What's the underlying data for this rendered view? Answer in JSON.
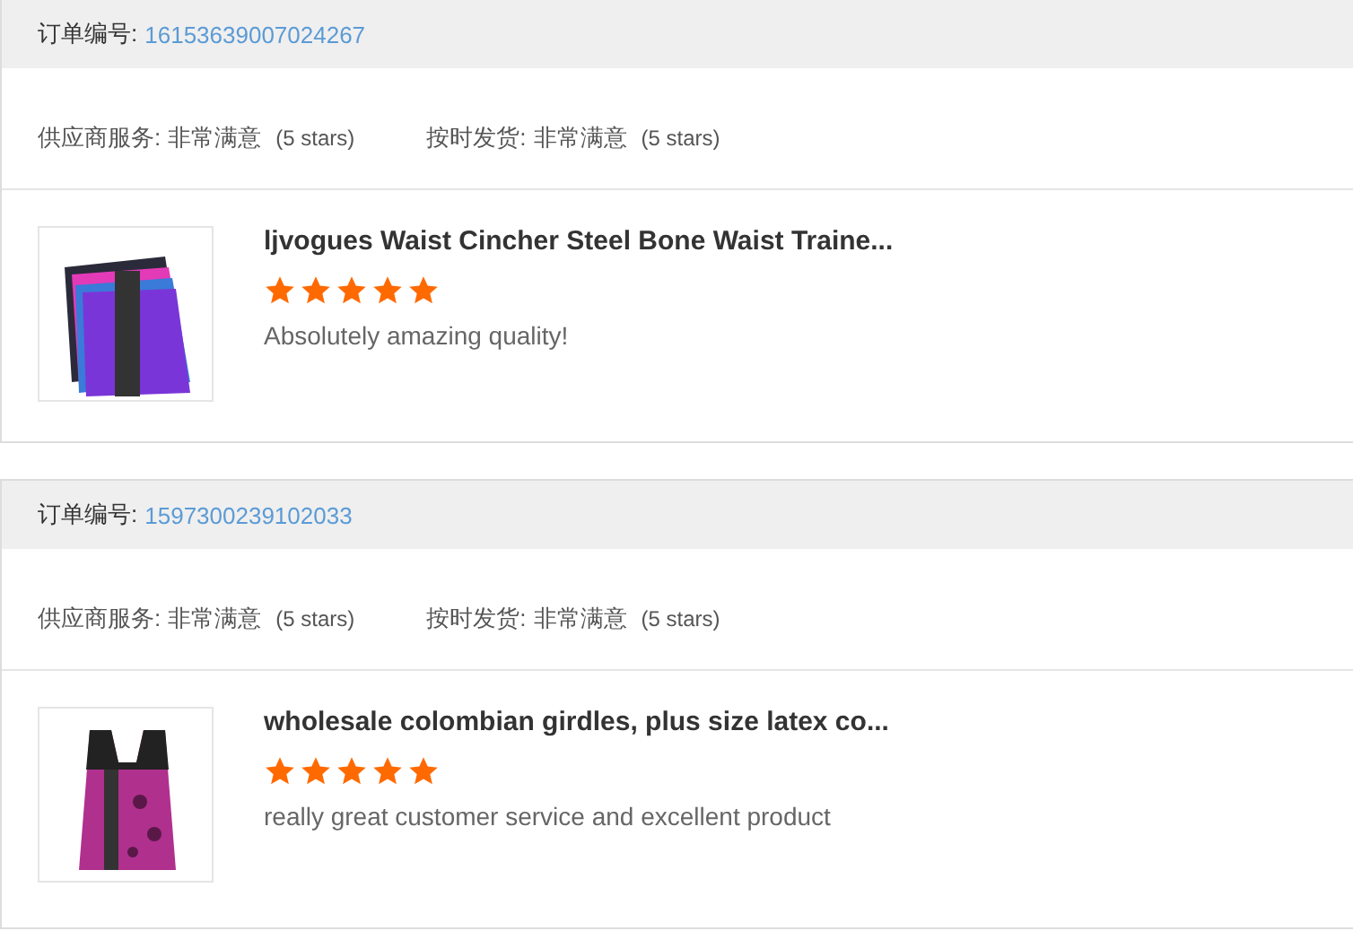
{
  "orders": [
    {
      "order_label": "订单编号:",
      "order_number": "16153639007024267",
      "ratings": [
        {
          "label": "供应商服务:",
          "value": "非常满意",
          "note": "(5 stars)"
        },
        {
          "label": "按时发货:",
          "value": "非常满意",
          "note": "(5 stars)"
        }
      ],
      "product": {
        "title": "ljvogues Waist Cincher Steel Bone Waist Traine...",
        "stars": 5,
        "review": "Absolutely amazing quality!"
      }
    },
    {
      "order_label": "订单编号:",
      "order_number": "1597300239102033",
      "ratings": [
        {
          "label": "供应商服务:",
          "value": "非常满意",
          "note": "(5 stars)"
        },
        {
          "label": "按时发货:",
          "value": "非常满意",
          "note": "(5 stars)"
        }
      ],
      "product": {
        "title": "wholesale colombian girdles, plus size latex co...",
        "stars": 5,
        "review": "really great customer service and excellent product"
      }
    }
  ]
}
